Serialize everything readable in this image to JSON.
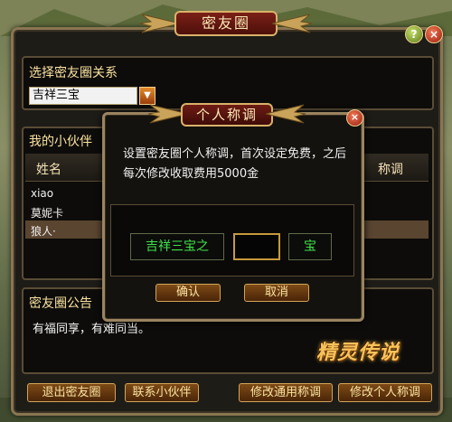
{
  "window": {
    "title": "密友圈"
  },
  "relation": {
    "label": "选择密友圈关系",
    "selected": "吉祥三宝"
  },
  "partners": {
    "label": "我的小伙伴",
    "columns": [
      "姓名",
      "称调"
    ],
    "rows": [
      {
        "name": "xiao"
      },
      {
        "name": "莫妮卡"
      },
      {
        "name": "狼人·"
      }
    ]
  },
  "announcement": {
    "label": "密友圈公告",
    "text": "有福同享，有难同当。"
  },
  "logo": "精灵传说",
  "bottom_buttons": {
    "exit": "退出密友圈",
    "contact": "联系小伙伴",
    "modify_common": "修改通用称调",
    "modify_personal": "修改个人称调"
  },
  "modal": {
    "title": "个人称调",
    "description": "设置密友圈个人称调，首次设定免费，之后每次修改收取费用5000金",
    "prefix": "吉祥三宝之",
    "input_value": "",
    "suffix": "宝",
    "confirm": "确认",
    "cancel": "取消"
  },
  "colors": {
    "gold_text": "#fbe3a0",
    "nickname_green": "#3fe24a",
    "panel_bg": "#1e1c17",
    "selected_row": "#5a4530"
  },
  "icons": {
    "help": "help-icon",
    "close": "close-icon",
    "dropdown": "chevron-down-icon"
  }
}
